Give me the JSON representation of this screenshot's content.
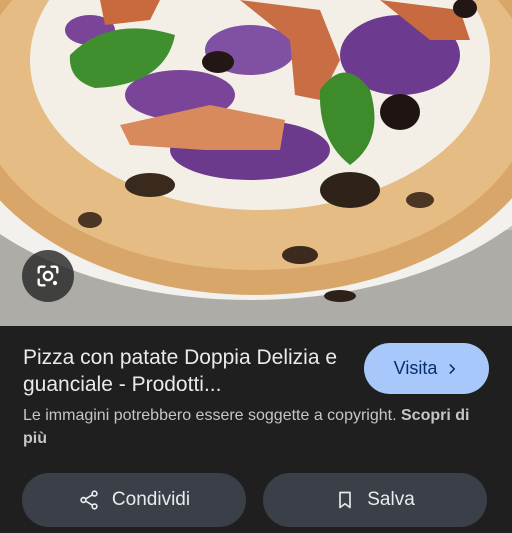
{
  "result": {
    "title": "Pizza con patate Doppia Delizia e guanciale - Prodotti...",
    "visit_label": "Visita",
    "copyright_text": "Le immagini potrebbero essere soggette a copyright.",
    "learn_more_label": "Scopri di più"
  },
  "actions": {
    "share_label": "Condividi",
    "save_label": "Salva"
  },
  "icons": {
    "lens": "google-lens-icon",
    "visit": "chevron-right-icon",
    "share": "share-icon",
    "save": "bookmark-icon"
  },
  "colors": {
    "panel_bg": "#1f1f1f",
    "visit_button": "#a8c7fa",
    "action_button": "#3b4048"
  }
}
